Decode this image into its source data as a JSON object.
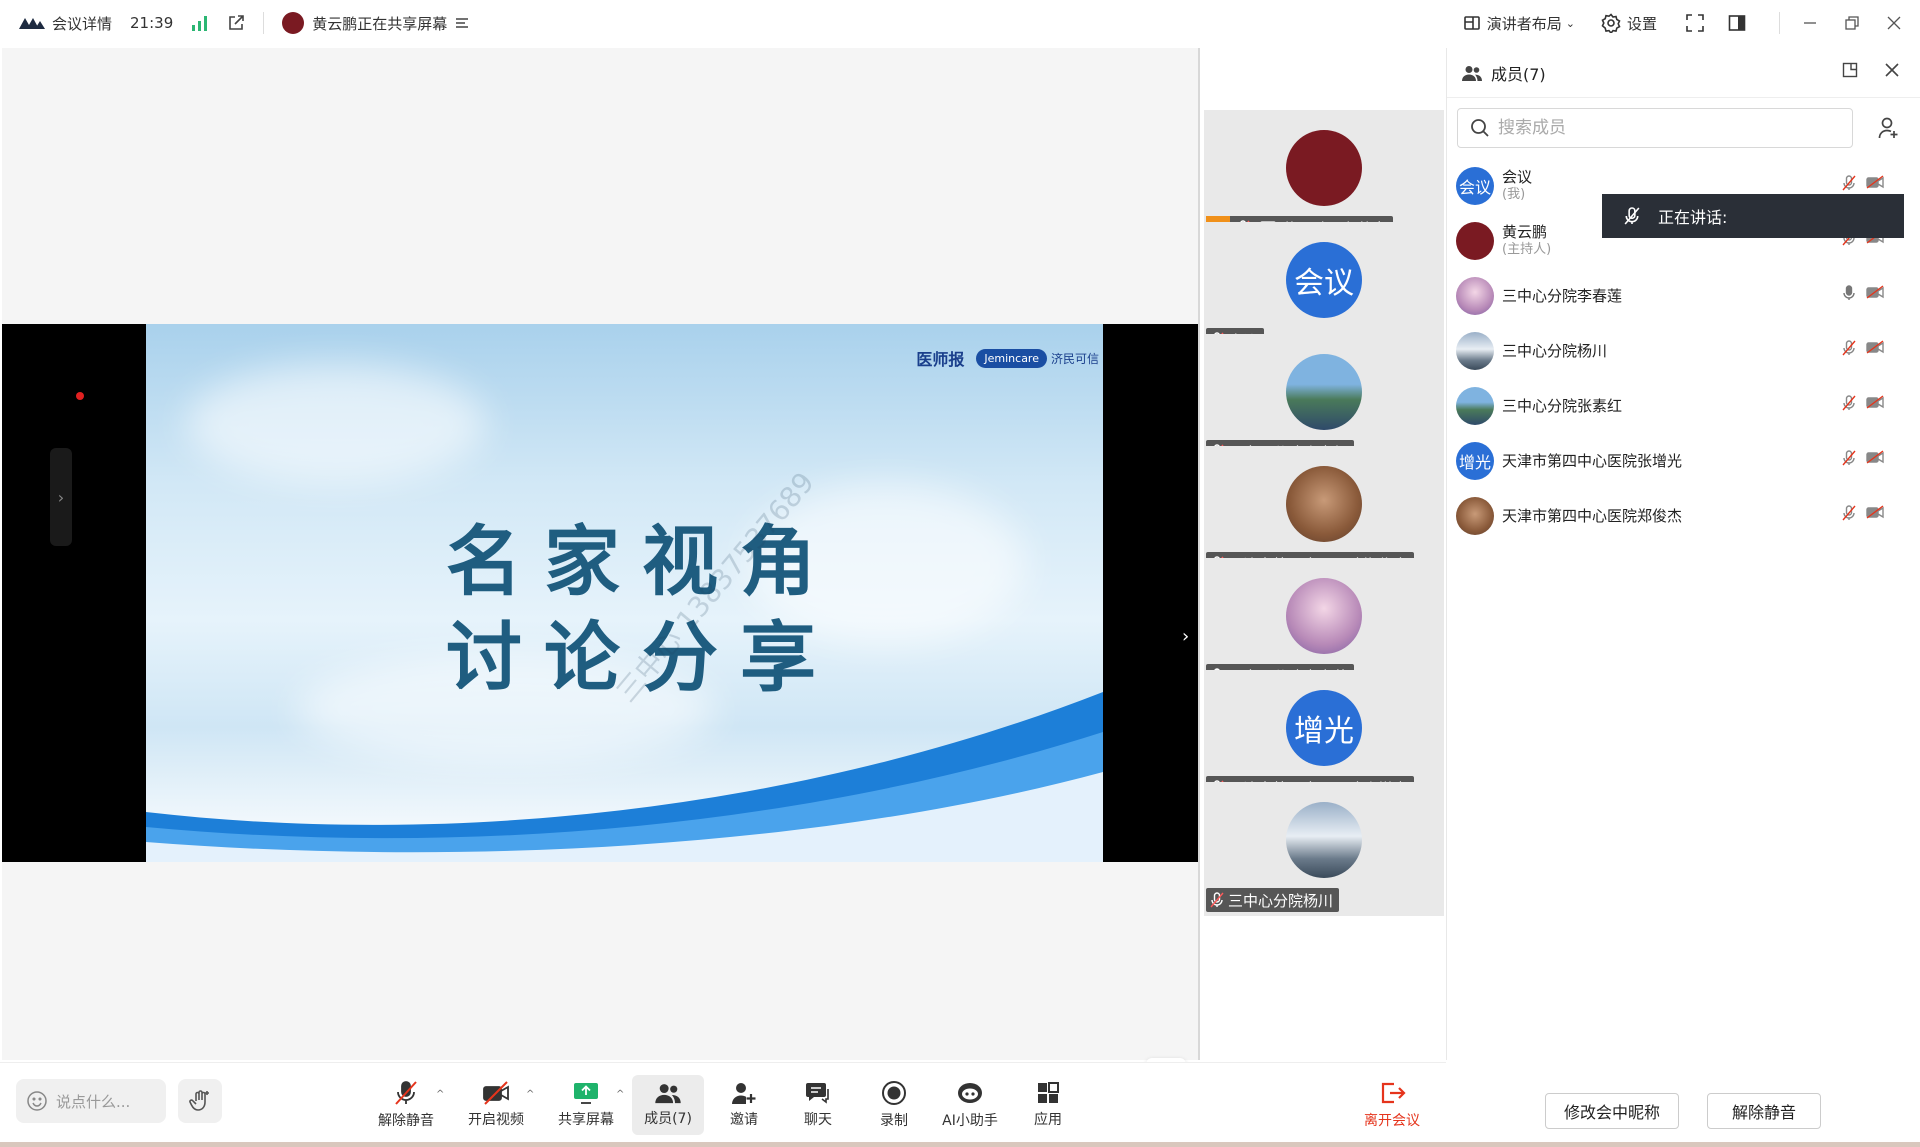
{
  "titlebar": {
    "meeting_details": "会议详情",
    "time": "21:39",
    "share_status": "黄云鹏正在共享屏幕",
    "layout": "演讲者布局",
    "settings": "设置"
  },
  "slide": {
    "line1": "名家视角",
    "line2": "讨论分享",
    "brand1": "医师报",
    "brand_pill": "Jemincare",
    "brand2": "济民可信",
    "watermark": "三中心 13837537689"
  },
  "tiles": [
    {
      "label": "黄云鹏正在共享",
      "avatar_text": "",
      "color": "#7a1a22",
      "host": true
    },
    {
      "label": "会议",
      "avatar_text": "会议",
      "color": "#2a6fd6",
      "host": false
    },
    {
      "label": "三中心分院张素红",
      "avatar_text": "",
      "color": "#4a7a5a",
      "host": false
    },
    {
      "label": "天津市第四中心医院郑俊杰",
      "avatar_text": "",
      "color": "#a86a4a",
      "host": false
    },
    {
      "label": "三中心分院李春莲",
      "avatar_text": "",
      "color": "#b88ab8",
      "host": false
    },
    {
      "label": "天津市第四中心医院张增光",
      "avatar_text": "增光",
      "color": "#2a6fd6",
      "host": false
    },
    {
      "label": "三中心分院杨川",
      "avatar_text": "",
      "color": "#7a8a9a",
      "host": false
    }
  ],
  "panel": {
    "title": "成员(7)",
    "search_placeholder": "搜索成员",
    "speaking": "正在讲话:",
    "members": [
      {
        "name": "会议",
        "sub": "(我)",
        "avatar_text": "会议",
        "color": "#2a6fd6"
      },
      {
        "name": "黄云鹏",
        "sub": "(主持人)",
        "avatar_text": "",
        "color": "#7a1a22"
      },
      {
        "name": "三中心分院李春莲",
        "sub": "",
        "avatar_text": "",
        "color": "#b88ab8"
      },
      {
        "name": "三中心分院杨川",
        "sub": "",
        "avatar_text": "",
        "color": "#7a8a9a"
      },
      {
        "name": "三中心分院张素红",
        "sub": "",
        "avatar_text": "",
        "color": "#4a7a5a"
      },
      {
        "name": "天津市第四中心医院张增光",
        "sub": "",
        "avatar_text": "增光",
        "color": "#2a6fd6"
      },
      {
        "name": "天津市第四中心医院郑俊杰",
        "sub": "",
        "avatar_text": "",
        "color": "#a86a4a"
      }
    ],
    "rename_button": "修改会中昵称",
    "unmute_button": "解除静音"
  },
  "toolbar": {
    "chat_placeholder": "说点什么...",
    "unmute": "解除静音",
    "start_video": "开启视频",
    "share_screen": "共享屏幕",
    "members": "成员(7)",
    "invite": "邀请",
    "chat": "聊天",
    "record": "录制",
    "ai": "AI小助手",
    "apps": "应用",
    "leave": "离开会议"
  },
  "colors": {
    "accent": "#2a6fd6",
    "danger": "#e5341c",
    "host_badge": "#f0901a"
  }
}
